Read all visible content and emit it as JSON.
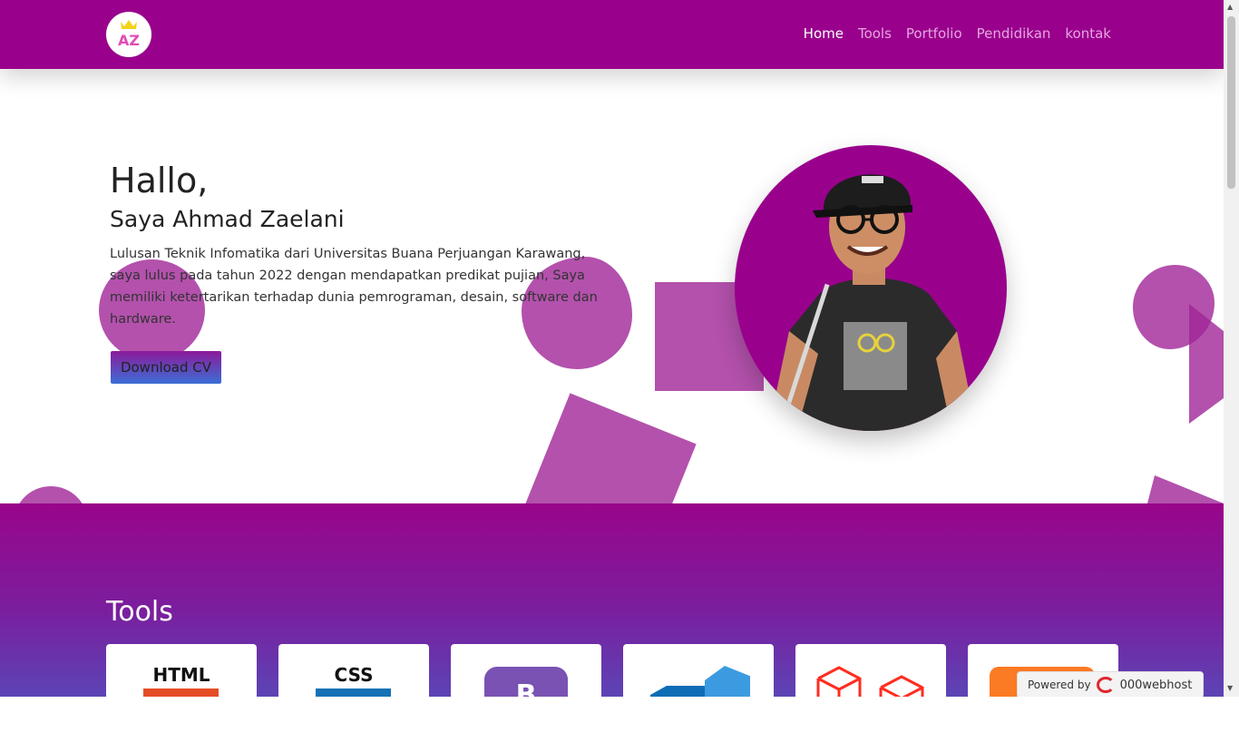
{
  "nav": {
    "logo_text": "AZ",
    "links": [
      "Home",
      "Tools",
      "Portfolio",
      "Pendidikan",
      "kontak"
    ]
  },
  "hero": {
    "greeting": "Hallo,",
    "name": "Saya Ahmad Zaelani",
    "description": "Lulusan Teknik Infomatika dari Universitas Buana Perjuangan Karawang, saya lulus pada tahun 2022 dengan mendapatkan predikat pujian, Saya memiliki ketertarikan terhadap dunia pemrograman, desain, software dan hardware.",
    "button_label": "Download CV"
  },
  "tools": {
    "title": "Tools",
    "cards": [
      {
        "label": "HTML",
        "icon": "html5-icon",
        "color": "#e44d26"
      },
      {
        "label": "CSS",
        "icon": "css3-icon",
        "color": "#1572b6"
      },
      {
        "label": "B",
        "icon": "bootstrap-icon",
        "color": "#7952b3"
      },
      {
        "label": "",
        "icon": "vscode-icon",
        "color": "#0078d4"
      },
      {
        "label": "",
        "icon": "laravel-icon",
        "color": "#ff2d20"
      },
      {
        "label": "",
        "icon": "xampp-icon",
        "color": "#fb7a24"
      }
    ]
  },
  "badge": {
    "powered_by": "Powered by",
    "host": "000webhost"
  },
  "colors": {
    "primary": "#99018c",
    "accent": "#a02597"
  }
}
